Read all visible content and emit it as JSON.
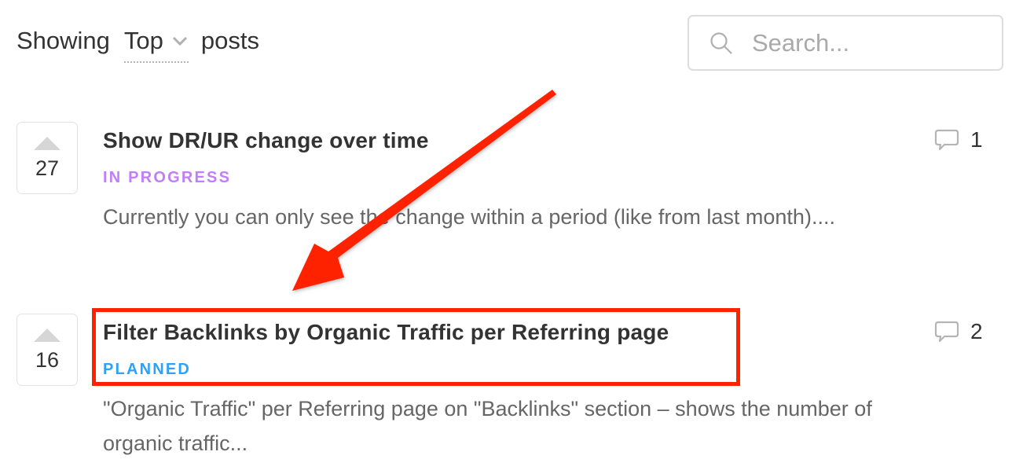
{
  "header": {
    "showing_label": "Showing",
    "sort_value": "Top",
    "posts_label": "posts"
  },
  "search": {
    "placeholder": "Search...",
    "value": ""
  },
  "posts": [
    {
      "votes": "27",
      "title": "Show DR/UR change over time",
      "status": "IN PROGRESS",
      "status_color": "#c27ef5",
      "description": "Currently you can only see the change within a period (like from last month)....",
      "comments": "1"
    },
    {
      "votes": "16",
      "title": "Filter Backlinks by Organic Traffic per Referring page",
      "status": "PLANNED",
      "status_color": "#2ea2f8",
      "description": "\"Organic Traffic\" per Referring page on \"Backlinks\" section – shows the number of organic traffic...",
      "comments": "2"
    }
  ],
  "annotation": {
    "color": "#ff2200"
  }
}
